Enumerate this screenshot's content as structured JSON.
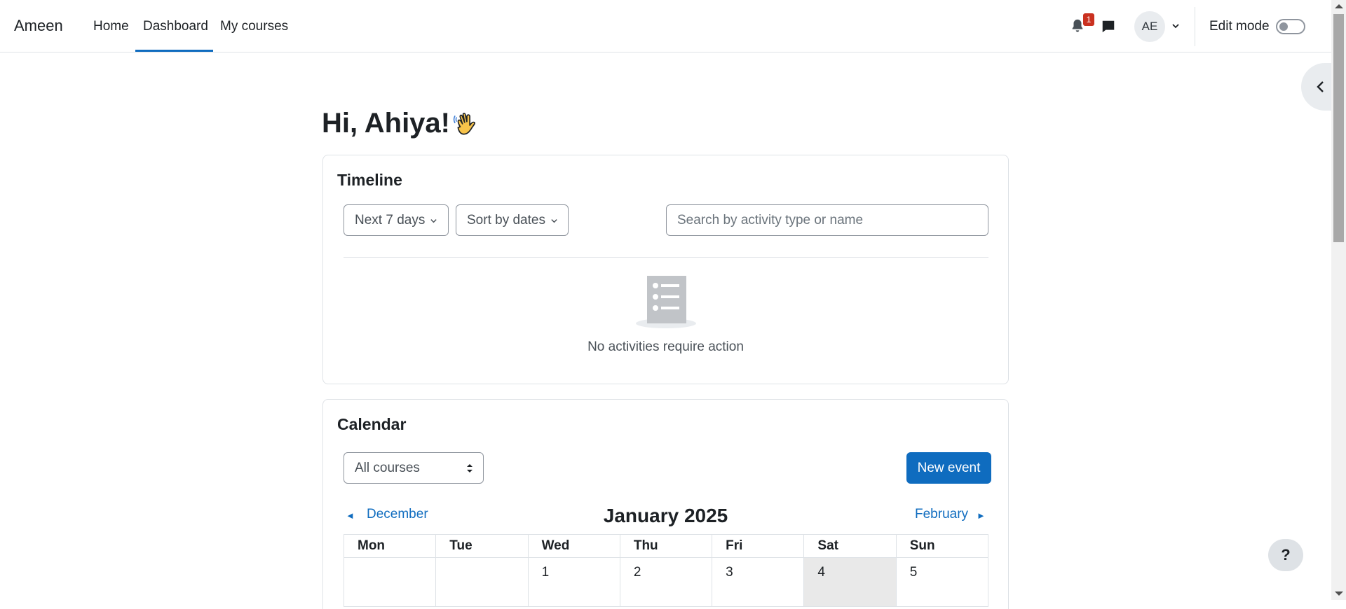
{
  "nav": {
    "brand": "Ameen",
    "links": [
      {
        "label": "Home"
      },
      {
        "label": "Dashboard"
      },
      {
        "label": "My courses"
      }
    ],
    "active": "Dashboard",
    "notification_count": "1",
    "avatar_initials": "AE",
    "edit_mode_label": "Edit mode",
    "edit_mode_on": false
  },
  "main": {
    "greeting": "Hi, Ahiya!",
    "greeting_emoji": "waving-hand-icon"
  },
  "timeline": {
    "title": "Timeline",
    "range_filter": "Next 7 days",
    "sort_filter": "Sort by dates",
    "search_placeholder": "Search by activity type or name",
    "empty_message": "No activities require action"
  },
  "calendar": {
    "title": "Calendar",
    "course_filter": "All courses",
    "new_event_label": "New event",
    "prev_month": "December",
    "next_month": "February",
    "month_title": "January 2025",
    "weekdays": [
      "Mon",
      "Tue",
      "Wed",
      "Thu",
      "Fri",
      "Sat",
      "Sun"
    ],
    "first_week": [
      "",
      "",
      "1",
      "2",
      "3",
      "4",
      "5"
    ]
  },
  "help_label": "?",
  "colors": {
    "accent": "#0f6cbf",
    "badge": "#ca3120",
    "text": "#1d2125"
  }
}
